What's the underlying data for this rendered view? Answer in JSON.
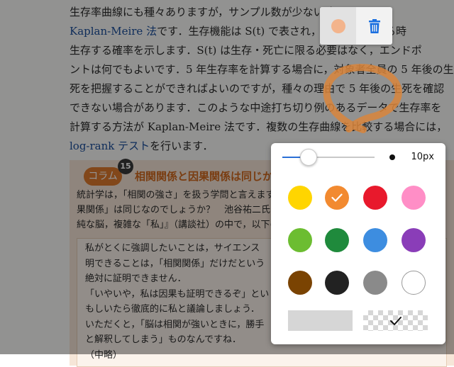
{
  "document": {
    "paragraph_lines": [
      {
        "a": "生存率曲線にも種々ありますが，サンプル数が少ない時によく",
        "b": "",
        "c": ""
      },
      {
        "a": "",
        "b": "Kaplan-Meire 法",
        "c": "です．生存機能は S(t) で表され，ある個人がある時"
      },
      {
        "a": "生存する確率を示します．S(t) は生存・死亡に限る必要はなく，エンドポ",
        "b": "",
        "c": ""
      },
      {
        "a": "ントは何でもよいです．5 年生存率を計算する場合に，対象者全員の 5 年後の生",
        "b": "",
        "c": ""
      },
      {
        "a": "死を把握することができればよいのですが，種々の理由で 5 年後の生死を確認",
        "b": "",
        "c": ""
      },
      {
        "a": "できない場合があります．このような中途打ち切り例のあるデータで生存率を",
        "b": "",
        "c": ""
      },
      {
        "a": "計算する方法が Kaplan-Meire 法です．複数の生存曲線を比較する場合には，",
        "b": "",
        "c": ""
      },
      {
        "a": "",
        "b": "log-rank テスト",
        "c": "を行います．"
      }
    ],
    "column": {
      "tag": "コラム",
      "number": "15",
      "title": "相関関係と因果関係は同じか",
      "intro_lines": [
        "統計学は，「相関の強さ」を扱う学問と言えます",
        "果関係」は同じなのでしょうか？　池谷祐二氏は",
        "純な脳，複雑な「私」』（講談社）の中で，以下の"
      ],
      "quote_lines": [
        "私がとくに強調したいことは，サイエンス",
        "明できることは，「相関関係」だけだという",
        "絶対に証明できません．",
        "「いやいや，私は因果も証明できるぞ」とい",
        "もしいたら徹底的に私と議論しましょう．",
        "いただくと，「脳は相関が強いときに，勝手",
        "と解釈してしまう」ものなんですね．",
        "（中略）"
      ]
    }
  },
  "colors": {
    "stroke": "#d9853b",
    "mini_pen": "#f3b48c",
    "trash": "#1a6fe0",
    "accent": "#2a6fd6"
  },
  "mini_toolbar": {
    "pen_icon": "pen-color-dot",
    "delete_icon": "trash-icon"
  },
  "panel": {
    "size_label": "10px",
    "size_fraction": 0.28,
    "swatches": [
      {
        "name": "yellow",
        "color": "#ffd500",
        "selected": false
      },
      {
        "name": "orange",
        "color": "#f28a30",
        "selected": true
      },
      {
        "name": "red",
        "color": "#e8192c",
        "selected": false
      },
      {
        "name": "pink",
        "color": "#ff8ec6",
        "selected": false
      },
      {
        "name": "light-green",
        "color": "#6cbd31",
        "selected": false
      },
      {
        "name": "dark-green",
        "color": "#1f8a3c",
        "selected": false
      },
      {
        "name": "blue",
        "color": "#3d8de0",
        "selected": false
      },
      {
        "name": "purple",
        "color": "#8a3db8",
        "selected": false
      },
      {
        "name": "brown",
        "color": "#7a4302",
        "selected": false
      },
      {
        "name": "black",
        "color": "#222222",
        "selected": false
      },
      {
        "name": "gray",
        "color": "#8a8a8a",
        "selected": false
      },
      {
        "name": "white",
        "color": "#ffffff",
        "selected": false
      }
    ],
    "styles": [
      {
        "name": "solid",
        "selected": false
      },
      {
        "name": "transparent",
        "selected": true
      }
    ]
  }
}
